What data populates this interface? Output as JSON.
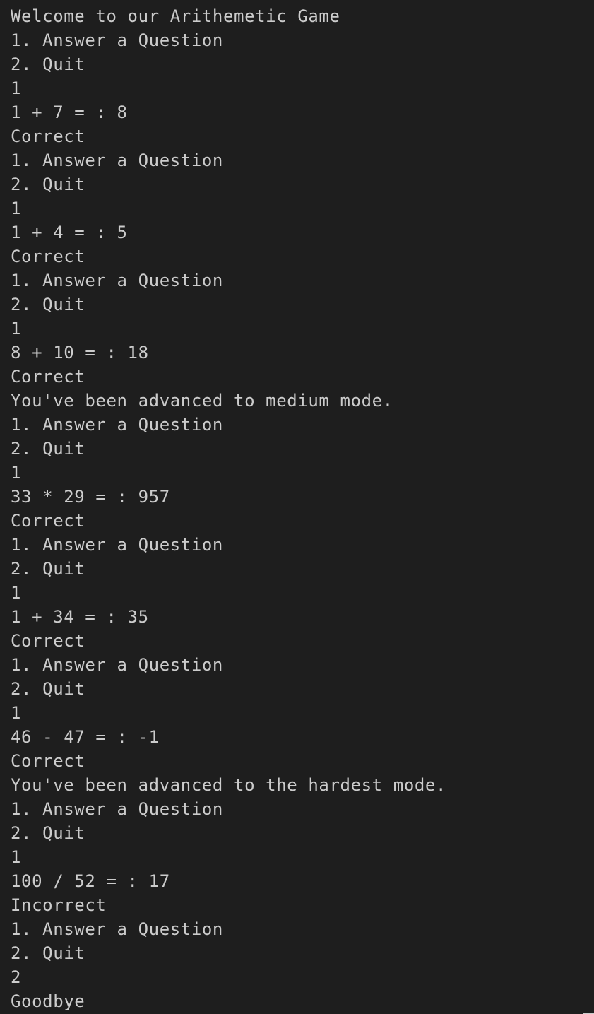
{
  "terminal": {
    "lines": [
      "Welcome to our Arithemetic Game",
      "1. Answer a Question",
      "2. Quit",
      "1",
      "1 + 7 = : 8",
      "Correct",
      "1. Answer a Question",
      "2. Quit",
      "1",
      "1 + 4 = : 5",
      "Correct",
      "1. Answer a Question",
      "2. Quit",
      "1",
      "8 + 10 = : 18",
      "Correct",
      "You've been advanced to medium mode.",
      "1. Answer a Question",
      "2. Quit",
      "1",
      "33 * 29 = : 957",
      "Correct",
      "1. Answer a Question",
      "2. Quit",
      "1",
      "1 + 34 = : 35",
      "Correct",
      "1. Answer a Question",
      "2. Quit",
      "1",
      "46 - 47 = : -1",
      "Correct",
      "You've been advanced to the hardest mode.",
      "1. Answer a Question",
      "2. Quit",
      "1",
      "100 / 52 = : 17",
      "Incorrect",
      "1. Answer a Question",
      "2. Quit",
      "2",
      "Goodbye"
    ]
  },
  "colors": {
    "background": "#1e1e1e",
    "text": "#cccccc"
  }
}
